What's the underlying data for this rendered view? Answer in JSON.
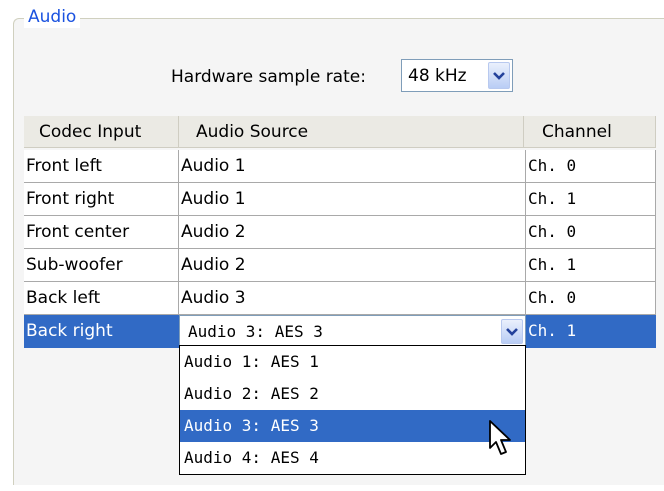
{
  "group": {
    "title": "Audio"
  },
  "sample_rate": {
    "label": "Hardware sample rate:",
    "value": "48 kHz"
  },
  "columns": [
    "Codec Input",
    "Audio Source",
    "Channel"
  ],
  "rows": [
    {
      "input": "Front left",
      "source": "Audio 1",
      "channel": "Ch. 0"
    },
    {
      "input": "Front right",
      "source": "Audio 1",
      "channel": "Ch. 1"
    },
    {
      "input": "Front center",
      "source": "Audio 2",
      "channel": "Ch. 0"
    },
    {
      "input": "Sub-woofer",
      "source": "Audio 2",
      "channel": "Ch. 1"
    },
    {
      "input": "Back left",
      "source": "Audio 3",
      "channel": "Ch. 0"
    },
    {
      "input": "Back right",
      "source": "Audio 3: AES 3",
      "channel": "Ch. 1",
      "selected": true
    }
  ],
  "dropdown": {
    "options": [
      "Audio 1: AES 1",
      "Audio 2: AES 2",
      "Audio 3: AES 3",
      "Audio 4: AES 4"
    ],
    "highlighted_index": 2
  },
  "colors": {
    "selection": "#316ac5",
    "group_title": "#1a52e0",
    "header_bg": "#ebeae4"
  },
  "icons": {
    "dropdown": "chevron-down-icon",
    "pointer": "mouse-pointer-icon"
  }
}
